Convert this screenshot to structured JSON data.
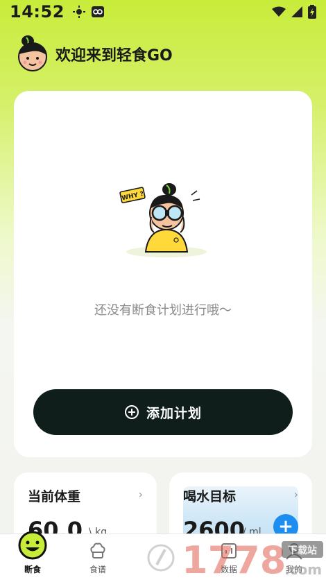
{
  "status_bar": {
    "time": "14:52",
    "left_icons": [
      "brightness-icon",
      "vpn-icon"
    ],
    "right_icons": [
      "wifi-icon",
      "signal-icon",
      "battery-icon"
    ]
  },
  "header": {
    "welcome_text": "欢迎来到轻食GO",
    "avatar_icon": "girl-avatar-icon"
  },
  "plan_card": {
    "illustration_bubble": "WHY ?",
    "empty_text": "还没有断食计划进行哦～",
    "add_button_label": "添加计划"
  },
  "weight_card": {
    "title": "当前体重",
    "value": "60.0",
    "unit": "kg"
  },
  "water_card": {
    "title": "喝水目标",
    "value": "2600",
    "unit": "ml"
  },
  "tabs": [
    {
      "label": "断食",
      "icon": "smile-icon",
      "active": true
    },
    {
      "label": "食谱",
      "icon": "chef-hat-icon",
      "active": false
    },
    {
      "label": "数据",
      "icon": "chart-icon",
      "active": false
    },
    {
      "label": "我的",
      "icon": "profile-icon",
      "active": false
    }
  ],
  "watermark": {
    "text": "1778",
    "badge": "下载站",
    "suffix": ".com"
  },
  "colors": {
    "accent_green": "#c8ec3a",
    "button_dark": "#0f1e1a",
    "water_blue": "#1d8ef0"
  }
}
